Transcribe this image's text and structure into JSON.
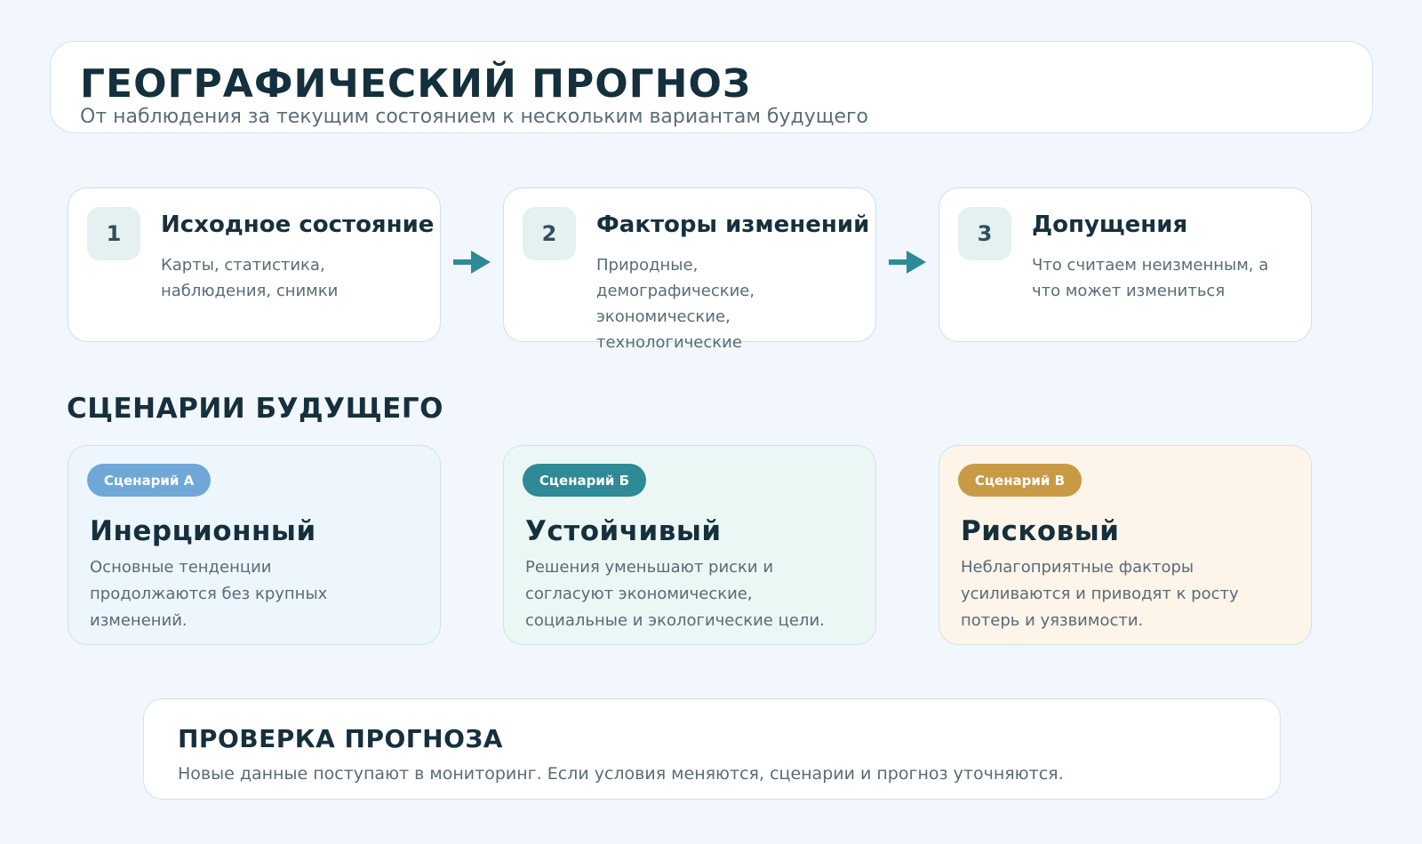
{
  "header": {
    "title": "ГЕОГРАФИЧЕСКИЙ ПРОГНОЗ",
    "subtitle": "От наблюдения за текущим состоянием к нескольким вариантам будущего"
  },
  "steps": [
    {
      "number": "1",
      "title": "Исходное состояние",
      "description": "Карты, статистика, наблюдения, снимки"
    },
    {
      "number": "2",
      "title": "Факторы изменений",
      "description": "Природные, демографические, экономические, технологические"
    },
    {
      "number": "3",
      "title": "Допущения",
      "description": "Что считаем неизменным, а что может измениться"
    }
  ],
  "scenarios_section": {
    "title": "СЦЕНАРИИ БУДУЩЕГО",
    "items": [
      {
        "badge": "Сценарий А",
        "title": "Инерционный",
        "description": "Основные тенденции продолжаются без крупных изменений.",
        "badge_color": "#6fa8d6",
        "bg_color": "#edf6fc"
      },
      {
        "badge": "Сценарий Б",
        "title": "Устойчивый",
        "description": "Решения уменьшают риски и согласуют экономические, социальные и экологические цели.",
        "badge_color": "#2e8a96",
        "bg_color": "#ebf7f5"
      },
      {
        "badge": "Сценарий В",
        "title": "Рисковый",
        "description": "Неблагоприятные факторы усиливаются и приводят к росту потерь и уязвимости.",
        "badge_color": "#c99a45",
        "bg_color": "#fdf4ea"
      }
    ]
  },
  "verification": {
    "title": "ПРОВЕРКА ПРОГНОЗА",
    "description": "Новые данные поступают в мониторинг. Если условия меняются, сценарии и прогноз уточняются."
  },
  "colors": {
    "arrow": "#2e8a96",
    "background": "#f1f7fd"
  }
}
